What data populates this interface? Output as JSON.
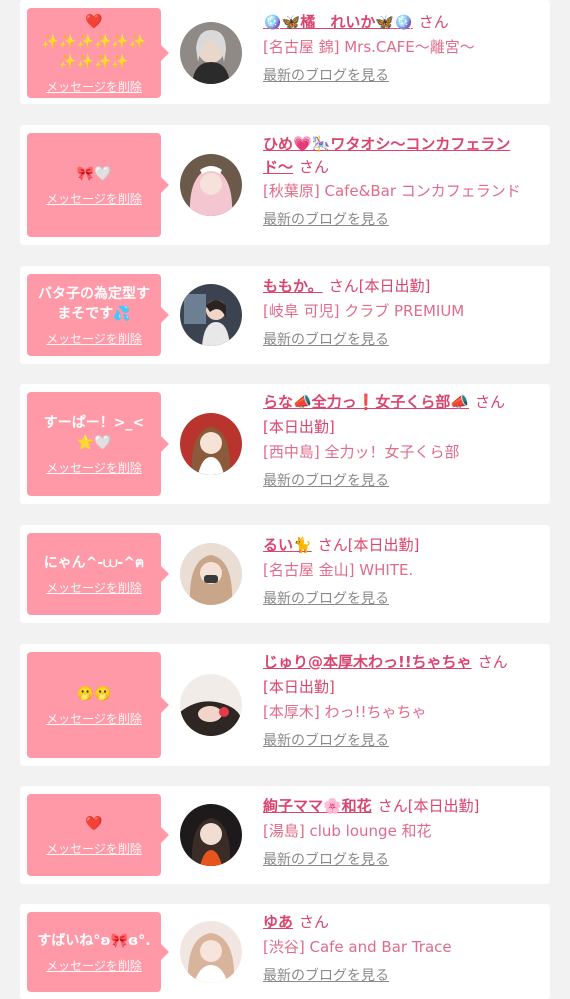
{
  "common": {
    "delete_label": "メッセージを削除",
    "blog_label": "最新のブログを見る",
    "san": "さん"
  },
  "colors": {
    "accent": "#d9456e",
    "bubble": "#ff99a8",
    "muted": "#8a8a8a",
    "background": "#f2f2f2"
  },
  "cards": [
    {
      "message": "❤️\n✨✨✨✨✨✨\n✨✨✨✨",
      "name": "🪩🦋橘　れいか🦋🪩",
      "name_suffix": "さん",
      "shop": "[名古屋 錦] Mrs.CAFE〜離宮〜"
    },
    {
      "message": "🎀🤍",
      "name": "ひめ💗🎠ワタオシ〜コンカフェランド〜",
      "name_suffix": "さん",
      "shop": "[秋葉原] Cafe&Bar コンカフェランド"
    },
    {
      "message": "バタ子の為定型す\nまそです💦",
      "name": "ももか。",
      "name_suffix": "さん[本日出勤]",
      "shop": "[岐阜 可児] クラブ PREMIUM"
    },
    {
      "message": "すーぱー！>_<\n⭐️🤍",
      "name": "らな📣全力っ❗️女子くら部📣",
      "name_suffix": "さん",
      "status": "[本日出勤]",
      "shop": "[西中島] 全力ッ！女子くら部"
    },
    {
      "message": "にゃん^-⩊-^ฅ",
      "name": "るい🐈",
      "name_suffix": "さん[本日出勤]",
      "shop": "[名古屋 金山] WHITE."
    },
    {
      "message": "🫢🫢",
      "name": "じゅり@本厚木わっ!!ちゃちゃ",
      "name_suffix": "さん",
      "status": "[本日出勤]",
      "shop": "[本厚木] わっ!!ちゃちゃ"
    },
    {
      "message": "❤️",
      "name": "絢子ママ🌸和花",
      "name_suffix": "さん[本日出勤]",
      "shop": "[湯島] club lounge 和花"
    },
    {
      "message": "すばいね°ʚ🎀ɞ°.",
      "name": "ゆあ",
      "name_suffix": "さん",
      "shop": "[渋谷] Cafe and Bar Trace"
    }
  ]
}
